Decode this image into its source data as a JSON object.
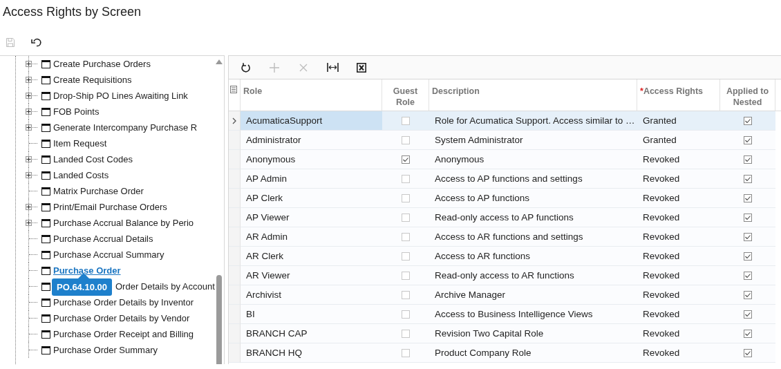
{
  "page_title": "Access Rights by Screen",
  "page_toolbar": [
    {
      "kind": "save",
      "disabled": true
    },
    {
      "kind": "undo",
      "disabled": false
    }
  ],
  "tree": {
    "items": [
      {
        "label": "Create Purchase Orders",
        "expandable": true,
        "selected": false
      },
      {
        "label": "Create Requisitions",
        "expandable": true,
        "selected": false
      },
      {
        "label": "Drop-Ship PO Lines Awaiting Link",
        "expandable": true,
        "selected": false
      },
      {
        "label": "FOB Points",
        "expandable": true,
        "selected": false
      },
      {
        "label": "Generate Intercompany Purchase R",
        "expandable": true,
        "selected": false
      },
      {
        "label": "Item Request",
        "expandable": false,
        "selected": false
      },
      {
        "label": "Landed Cost Codes",
        "expandable": true,
        "selected": false
      },
      {
        "label": "Landed Costs",
        "expandable": true,
        "selected": false
      },
      {
        "label": "Matrix Purchase Order",
        "expandable": false,
        "selected": false
      },
      {
        "label": "Print/Email Purchase Orders",
        "expandable": true,
        "selected": false
      },
      {
        "label": "Purchase Accrual Balance by Perio",
        "expandable": true,
        "selected": false
      },
      {
        "label": "Purchase Accrual Details",
        "expandable": false,
        "selected": false
      },
      {
        "label": "Purchase Accrual Summary",
        "expandable": false,
        "selected": false
      },
      {
        "label": "Purchase Order",
        "expandable": false,
        "selected": true,
        "tooltip": "PO.64.10.00"
      },
      {
        "label": "Order Details by Account",
        "expandable": false,
        "selected": false
      },
      {
        "label": "Purchase Order Details by Inventor",
        "expandable": false,
        "selected": false
      },
      {
        "label": "Purchase Order Details by Vendor",
        "expandable": false,
        "selected": false
      },
      {
        "label": "Purchase Order Receipt and Billing",
        "expandable": false,
        "selected": false
      },
      {
        "label": "Purchase Order Summary",
        "expandable": false,
        "selected": false
      }
    ]
  },
  "grid_toolbar": [
    {
      "kind": "refresh",
      "disabled": false
    },
    {
      "kind": "add",
      "disabled": true
    },
    {
      "kind": "delete",
      "disabled": true
    },
    {
      "kind": "fit",
      "disabled": false
    },
    {
      "kind": "excel",
      "disabled": false
    }
  ],
  "table": {
    "columns": [
      {
        "label": "Role",
        "kind": "text"
      },
      {
        "label": "Guest Role",
        "kind": "checkbox"
      },
      {
        "label": "Description",
        "kind": "text"
      },
      {
        "label": "Access Rights",
        "kind": "text",
        "required_mark": "*"
      },
      {
        "label": "Applied to Nested",
        "kind": "checkbox"
      }
    ],
    "rows": [
      {
        "role": "AcumaticaSupport",
        "guest_role": false,
        "description": "Role for Acumatica Support. Access similar to …",
        "access_rights": "Granted",
        "applied_to_nested": true,
        "selected": true
      },
      {
        "role": "Administrator",
        "guest_role": false,
        "description": "System Administrator",
        "access_rights": "Granted",
        "applied_to_nested": true,
        "selected": false
      },
      {
        "role": "Anonymous",
        "guest_role": true,
        "description": "Anonymous",
        "access_rights": "Revoked",
        "applied_to_nested": true,
        "selected": false
      },
      {
        "role": "AP Admin",
        "guest_role": false,
        "description": "Access to AP functions and settings",
        "access_rights": "Revoked",
        "applied_to_nested": true,
        "selected": false
      },
      {
        "role": "AP Clerk",
        "guest_role": false,
        "description": "Access to AP functions",
        "access_rights": "Revoked",
        "applied_to_nested": true,
        "selected": false
      },
      {
        "role": "AP Viewer",
        "guest_role": false,
        "description": "Read-only access to AP functions",
        "access_rights": "Revoked",
        "applied_to_nested": true,
        "selected": false
      },
      {
        "role": "AR Admin",
        "guest_role": false,
        "description": "Access to AR functions and settings",
        "access_rights": "Revoked",
        "applied_to_nested": true,
        "selected": false
      },
      {
        "role": "AR Clerk",
        "guest_role": false,
        "description": "Access to AR functions",
        "access_rights": "Revoked",
        "applied_to_nested": true,
        "selected": false
      },
      {
        "role": "AR Viewer",
        "guest_role": false,
        "description": "Read-only access to AR functions",
        "access_rights": "Revoked",
        "applied_to_nested": true,
        "selected": false
      },
      {
        "role": "Archivist",
        "guest_role": false,
        "description": "Archive Manager",
        "access_rights": "Revoked",
        "applied_to_nested": true,
        "selected": false
      },
      {
        "role": "BI",
        "guest_role": false,
        "description": "Access to Business Intelligence Views",
        "access_rights": "Revoked",
        "applied_to_nested": true,
        "selected": false
      },
      {
        "role": "BRANCH CAP",
        "guest_role": false,
        "description": "Revision Two Capital Role",
        "access_rights": "Revoked",
        "applied_to_nested": true,
        "selected": false
      },
      {
        "role": "BRANCH HQ",
        "guest_role": false,
        "description": "Product Company Role",
        "access_rights": "Revoked",
        "applied_to_nested": true,
        "selected": false
      }
    ]
  }
}
